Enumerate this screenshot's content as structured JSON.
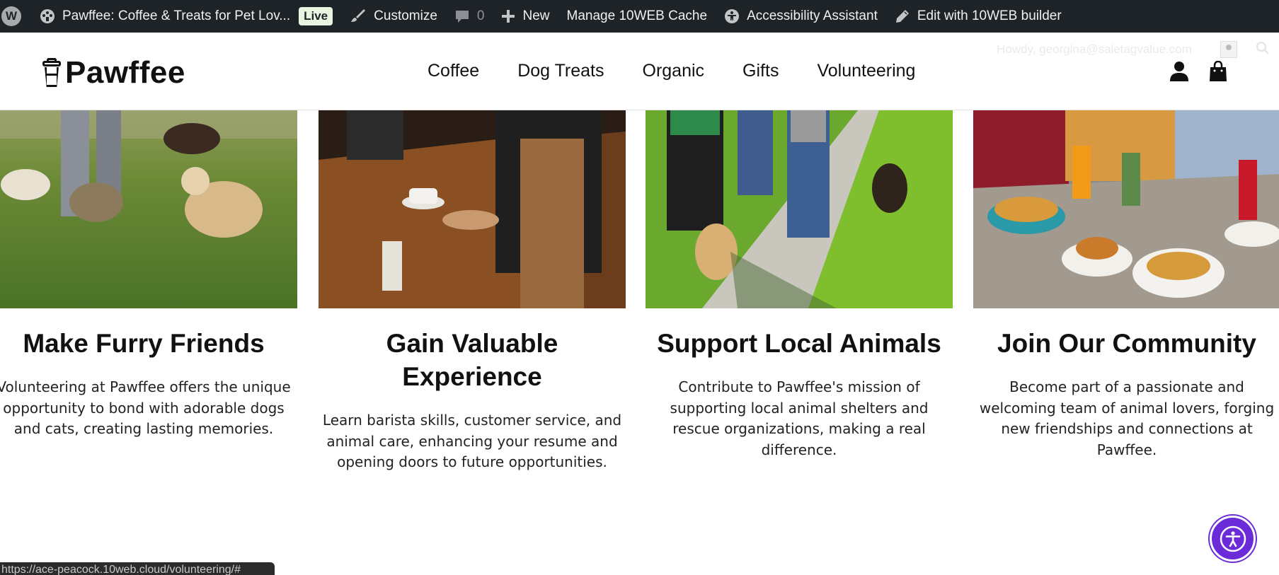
{
  "adminbar": {
    "wp_logo": "W",
    "site_name": "Pawffee: Coffee & Treats for Pet Lov...",
    "live_label": "Live",
    "customize_label": "Customize",
    "comments_count": "0",
    "new_label": "New",
    "cache_label": "Manage 10WEB Cache",
    "accessibility_label": "Accessibility Assistant",
    "edit_label": "Edit with 10WEB builder",
    "howdy": "Howdy, georgina@saletagvalue.com"
  },
  "header": {
    "logo_text": "Pawffee",
    "nav": [
      {
        "label": "Coffee"
      },
      {
        "label": "Dog Treats"
      },
      {
        "label": "Organic"
      },
      {
        "label": "Gifts"
      },
      {
        "label": "Volunteering"
      }
    ]
  },
  "cards": [
    {
      "title": "Make Furry Friends",
      "text": "Volunteering at Pawffee offers the unique opportunity to bond with adorable dogs and cats, creating lasting memories."
    },
    {
      "title": "Gain Valuable Experience",
      "text": "Learn barista skills, customer service, and animal care, enhancing your resume and opening doors to future opportunities."
    },
    {
      "title": "Support Local Animals",
      "text": "Contribute to Pawffee's mission of supporting local animal shelters and rescue organizations, making a real difference."
    },
    {
      "title": "Join Our Community",
      "text": "Become part of a passionate and welcoming team of animal lovers, forging new friendships and connections at Pawffee."
    }
  ],
  "status_url": "https://ace-peacock.10web.cloud/volunteering/#",
  "colors": {
    "adminbar": "#1d2327",
    "accessibility_button": "#6c2bd9",
    "live_badge": "#e8f5e1"
  },
  "icons": [
    "wordpress-icon",
    "dashboard-icon",
    "brush-icon",
    "comment-icon",
    "plus-icon",
    "accessibility-icon",
    "pencil-icon",
    "coffee-cup-logo-icon",
    "user-icon",
    "shopping-bag-icon",
    "search-icon"
  ]
}
